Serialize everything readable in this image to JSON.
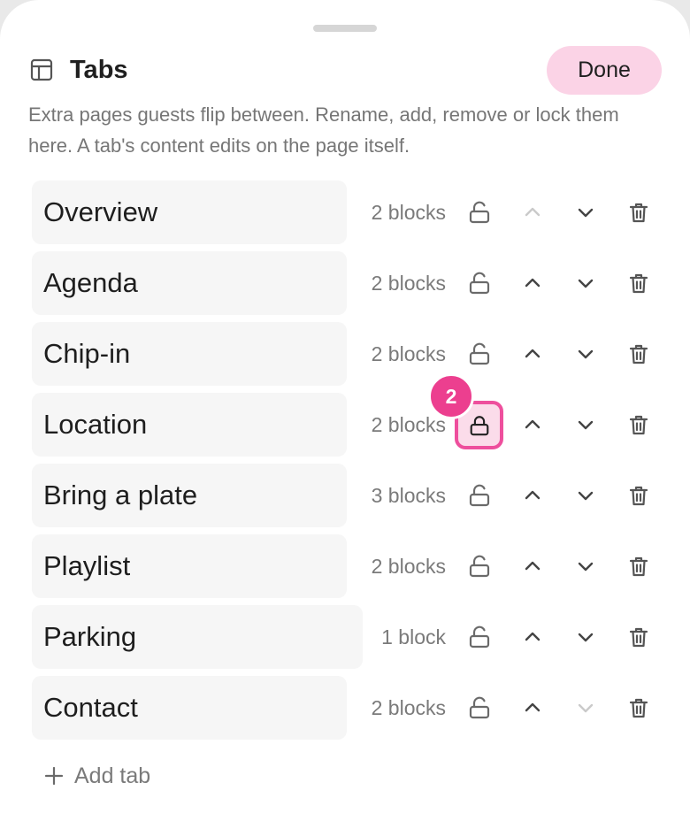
{
  "header": {
    "title": "Tabs",
    "icon": "layout-icon",
    "done_label": "Done",
    "description": "Extra pages guests flip between. Rename, add, remove or lock them here. A tab's content edits on the page itself."
  },
  "tabs": [
    {
      "name": "Overview",
      "count": "2 blocks",
      "up_disabled": true,
      "down_disabled": false
    },
    {
      "name": "Agenda",
      "count": "2 blocks",
      "up_disabled": false,
      "down_disabled": false
    },
    {
      "name": "Chip-in",
      "count": "2 blocks",
      "up_disabled": false,
      "down_disabled": false
    },
    {
      "name": "Location",
      "count": "2 blocks",
      "up_disabled": false,
      "down_disabled": false,
      "highlighted": true,
      "badge": "2"
    },
    {
      "name": "Bring a plate",
      "count": "3 blocks",
      "up_disabled": false,
      "down_disabled": false
    },
    {
      "name": "Playlist",
      "count": "2 blocks",
      "up_disabled": false,
      "down_disabled": false
    },
    {
      "name": "Parking",
      "count": "1 block",
      "up_disabled": false,
      "down_disabled": false
    },
    {
      "name": "Contact",
      "count": "2 blocks",
      "up_disabled": false,
      "down_disabled": true
    }
  ],
  "add_tab_label": "Add tab",
  "colors": {
    "accent": "#ec3f8f",
    "done_bg": "#fbd3e6",
    "highlight_bg": "#fbdcea",
    "field_bg": "#f6f6f6",
    "muted_text": "#767676"
  }
}
